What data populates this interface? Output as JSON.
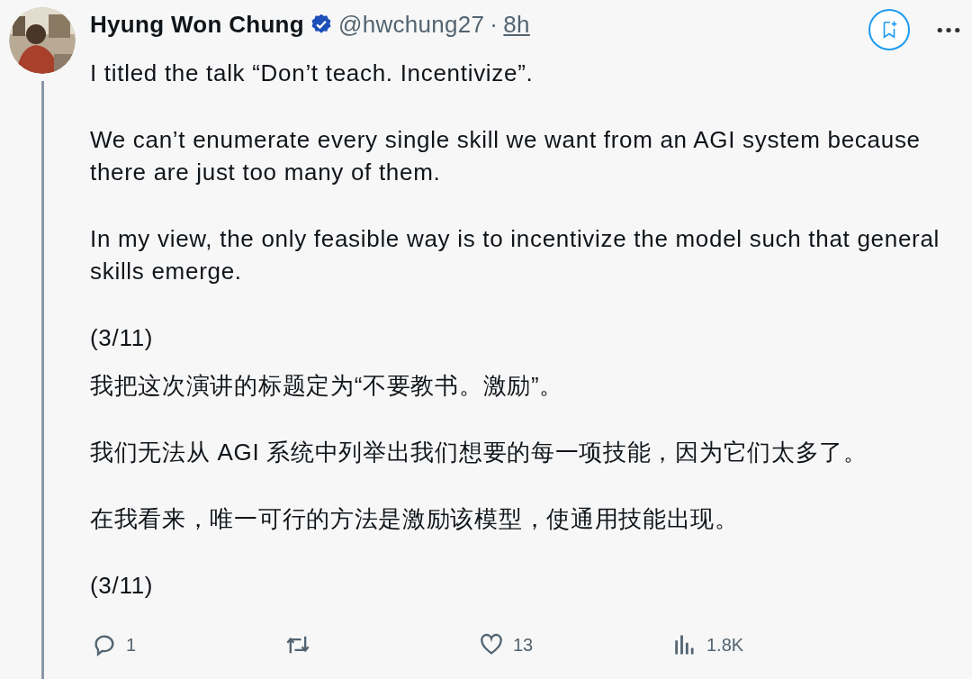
{
  "author": {
    "name": "Hyung Won Chung",
    "verified": true,
    "handle": "@hwchung27",
    "separator": "·",
    "time": "8h"
  },
  "body": {
    "english": [
      "I titled the talk “Don’t teach. Incentivize”.",
      "We can’t enumerate every single skill we want from an AGI system because there are just too many of them.",
      "In my view, the only feasible way is to incentivize the model such that general skills emerge.",
      "(3/11)"
    ],
    "chinese": [
      "我把这次演讲的标题定为“不要教书。激励”。",
      "我们无法从 AGI 系统中列举出我们想要的每一项技能，因为它们太多了。",
      "在我看来，唯一可行的方法是激励该模型，使通用技能出现。",
      "(3/11)"
    ]
  },
  "actions": [
    {
      "kind": "reply",
      "count": "1"
    },
    {
      "kind": "retweet"
    },
    {
      "kind": "like",
      "count": "13"
    },
    {
      "kind": "views",
      "count": "1.8K"
    }
  ]
}
